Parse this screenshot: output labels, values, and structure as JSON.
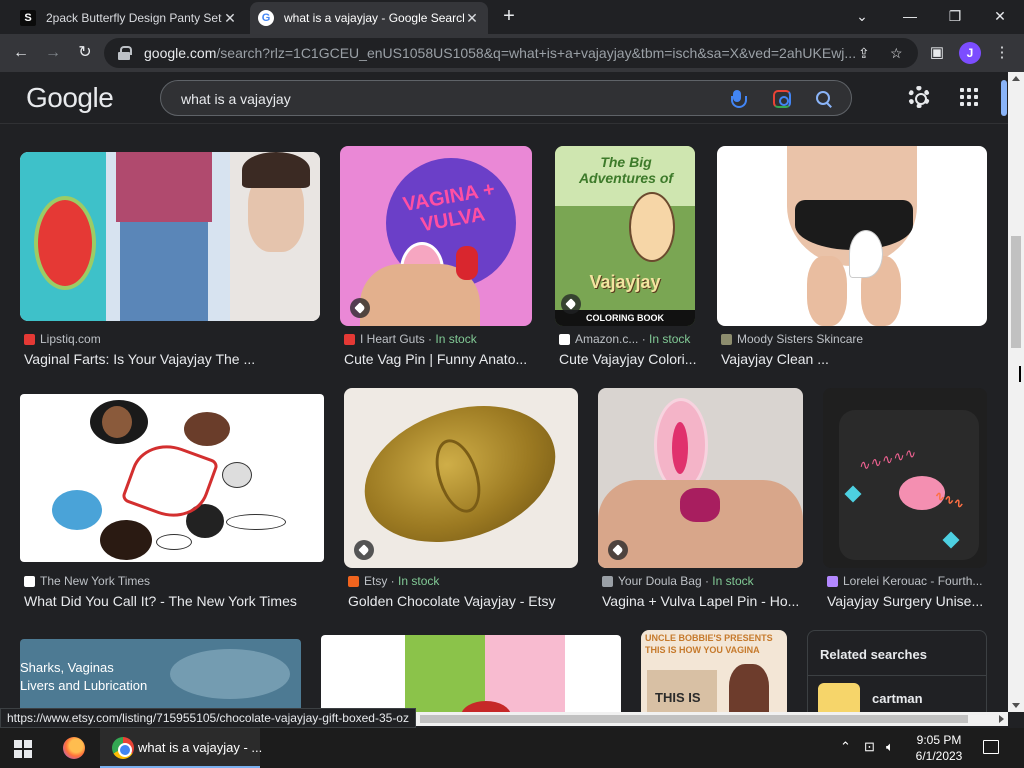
{
  "browser": {
    "tabs": [
      {
        "favicon": "S",
        "title": "2pack Butterfly Design Panty Set"
      },
      {
        "favicon": "G",
        "title": "what is a vajayjay - Google Search"
      }
    ],
    "url_host": "google.com",
    "url_rest": "/search?rlz=1C1GCEU_enUS1058US1058&q=what+is+a+vajayjay&tbm=isch&sa=X&ved=2ahUKEwj...",
    "profile_initial": "J",
    "status_url": "https://www.etsy.com/listing/715955105/chocolate-vajayjay-gift-boxed-35-oz"
  },
  "google": {
    "logo": "Google",
    "query": "what is a vajayjay"
  },
  "results": [
    {
      "source": "Lipstiq.com",
      "in_stock": "",
      "title": "Vaginal Farts: Is Your Vajayjay The ...",
      "src_color": "#e53935"
    },
    {
      "source": "I Heart Guts",
      "in_stock": "In stock",
      "title": "Cute Vag Pin | Funny Anato...",
      "src_color": "#e53935"
    },
    {
      "source": "Amazon.c...",
      "in_stock": "In stock",
      "title": "Cute Vajayjay Colori...",
      "src_color": "#ffffff"
    },
    {
      "source": "Moody Sisters Skincare",
      "in_stock": "",
      "title": "Vajayjay Clean ...",
      "src_color": "#8d8d6e"
    },
    {
      "source": "The New York Times",
      "in_stock": "",
      "title": "What Did You Call It? - The New York Times",
      "src_color": "#ffffff"
    },
    {
      "source": "Etsy",
      "in_stock": "In stock",
      "title": "Golden Chocolate Vajayjay - Etsy",
      "src_color": "#f1641e"
    },
    {
      "source": "Your Doula Bag",
      "in_stock": "In stock",
      "title": "Vagina + Vulva Lapel Pin - Ho...",
      "src_color": "#9aa0a6"
    },
    {
      "source": "Lorelei Kerouac - Fourth...",
      "in_stock": "",
      "title": "Vajayjay Surgery Unise...",
      "src_color": "#b388ff"
    }
  ],
  "thumb_text": {
    "pin": "VAGINA + VULVA",
    "book_top": "The Big Adventures of",
    "book_title": "Vajayjay",
    "book_bottom": "COLORING BOOK",
    "sharks": "Sharks, Vaginas\nLivers and Lubrication",
    "uncle": "UNCLE BOBBIE'S PRESENTS THIS IS HOW YOU VAGINA",
    "this_is": "THIS IS"
  },
  "related": {
    "title": "Related searches",
    "item": "cartman"
  },
  "taskbar": {
    "chrome_label": "what is a vajayjay - ...",
    "time": "9:05 PM",
    "date": "6/1/2023"
  }
}
